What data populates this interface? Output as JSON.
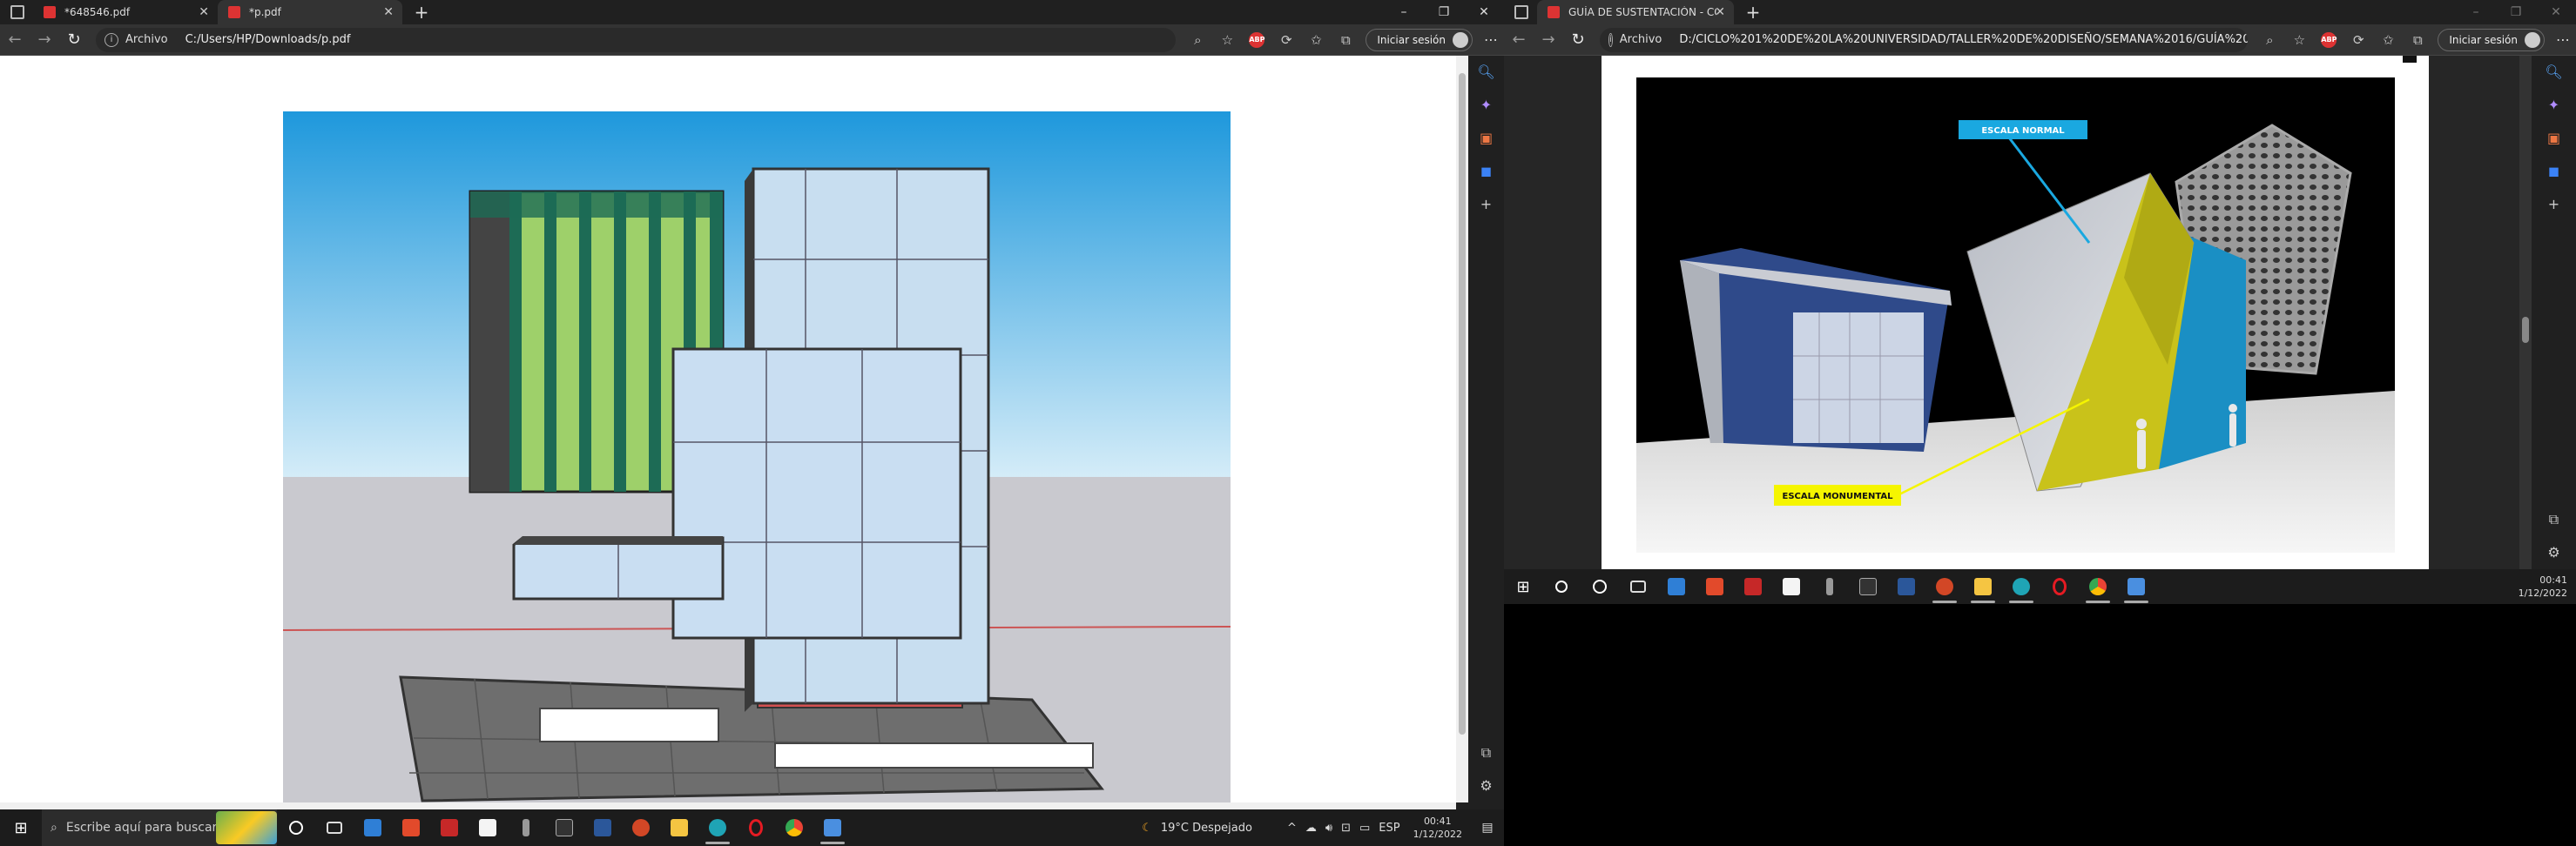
{
  "left_window": {
    "tabs": [
      {
        "title": "*648546.pdf",
        "active": false
      },
      {
        "title": "*p.pdf",
        "active": true
      }
    ],
    "address": {
      "scheme": "Archivo",
      "path": "C:/Users/HP/Downloads/p.pdf"
    },
    "signin_label": "Iniciar sesión",
    "adblock_label": "ABP"
  },
  "right_window": {
    "tabs": [
      {
        "title": "GUÍA DE SUSTENTACIÓN - CON",
        "active": true
      }
    ],
    "address": {
      "scheme": "Archivo",
      "path": "D:/CICLO%201%20DE%20LA%20UNIVERSIDAD/TALLER%20DE%20DISEÑO/SEMANA%2016/GUÍA%20DE%..."
    },
    "signin_label": "Iniciar sesión",
    "adblock_label": "ABP",
    "image_labels": {
      "normal": "ESCALA NORMAL",
      "monumental": "ESCALA MONUMENTAL"
    }
  },
  "left_taskbar": {
    "search_placeholder": "Escribe aquí para buscar",
    "weather": "19°C Despejado",
    "language": "ESP",
    "time": "00:41",
    "date": "1/12/2022"
  },
  "right_taskbar": {
    "time": "00:41",
    "date": "1/12/2022"
  },
  "colors": {
    "chrome_dark": "#202020",
    "toolbar": "#333333",
    "sky": "#2b9fe0",
    "ground": "#c8c8ce",
    "accent_cyan": "#1aa8e0",
    "accent_yellow": "#f5f500"
  }
}
